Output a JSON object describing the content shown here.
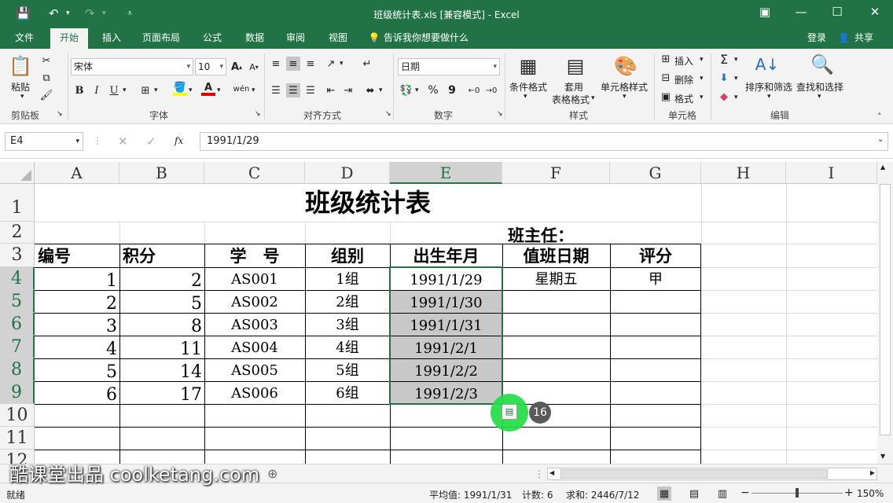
{
  "titlebar": {
    "doc_title": "班级统计表.xls  [兼容模式] - Excel",
    "icons": [
      "save-icon",
      "undo-icon",
      "redo-icon",
      "customize-icon",
      "ribbon-display-icon",
      "minimize-icon",
      "maximize-icon",
      "close-icon"
    ]
  },
  "tabs": [
    "文件",
    "开始",
    "插入",
    "页面布局",
    "公式",
    "数据",
    "审阅",
    "视图"
  ],
  "active_tab": "开始",
  "tell_me": "告诉我你想要做什么",
  "login": "登录",
  "share": "共享",
  "ribbon": {
    "clipboard": {
      "paste": "粘贴",
      "label": "剪贴板"
    },
    "font": {
      "name": "宋体",
      "size": "10",
      "bold": "B",
      "italic": "I",
      "underline": "U",
      "label": "字体",
      "increase": "A",
      "decrease": "A",
      "phonetic": "wén"
    },
    "alignment": {
      "label": "对齐方式"
    },
    "number": {
      "format": "日期",
      "percent": "%",
      "comma": "9",
      "label": "数字"
    },
    "styles": {
      "conditional": "条件格式",
      "table_a": "套用",
      "table_b": "表格格式",
      "cell_styles": "单元格样式",
      "label": "样式"
    },
    "cells": {
      "insert": "插入",
      "delete": "删除",
      "format": "格式",
      "label": "单元格"
    },
    "editing": {
      "sort": "排序和筛选",
      "find": "查找和选择",
      "label": "编辑"
    }
  },
  "formula_bar": {
    "name_box": "E4",
    "fx": "fx",
    "value": "1991/1/29"
  },
  "columns": [
    "A",
    "B",
    "C",
    "D",
    "E",
    "F",
    "G",
    "H",
    "I"
  ],
  "rows": [
    "1",
    "2",
    "3",
    "4",
    "5",
    "6",
    "7",
    "8",
    "9",
    "10",
    "11",
    "12"
  ],
  "sheet": {
    "title": "班级统计表",
    "subtitle": "班主任：",
    "headers": [
      "编号",
      "积分",
      "学　号",
      "组别",
      "出生年月",
      "值班日期",
      "评分"
    ],
    "data": [
      [
        "1",
        "2",
        "AS001",
        "1组",
        "1991/1/29",
        "星期五",
        "甲"
      ],
      [
        "2",
        "5",
        "AS002",
        "2组",
        "1991/1/30",
        "",
        ""
      ],
      [
        "3",
        "8",
        "AS003",
        "3组",
        "1991/1/31",
        "",
        ""
      ],
      [
        "4",
        "11",
        "AS004",
        "4组",
        "1991/2/1",
        "",
        ""
      ],
      [
        "5",
        "14",
        "AS005",
        "5组",
        "1991/2/2",
        "",
        ""
      ],
      [
        "6",
        "17",
        "AS006",
        "6组",
        "1991/2/3",
        "",
        ""
      ]
    ]
  },
  "annotation": {
    "step": "16"
  },
  "status": {
    "ready": "就绪",
    "average": "平均值: 1991/1/31",
    "count": "计数: 6",
    "sum": "求和: 2446/7/12",
    "zoom": "150%"
  },
  "watermark": "酷课堂出品  coolketang.com",
  "colors": {
    "accent": "#217346",
    "selection_fill": "#c8c8c8",
    "highlight": "#22dd44"
  }
}
